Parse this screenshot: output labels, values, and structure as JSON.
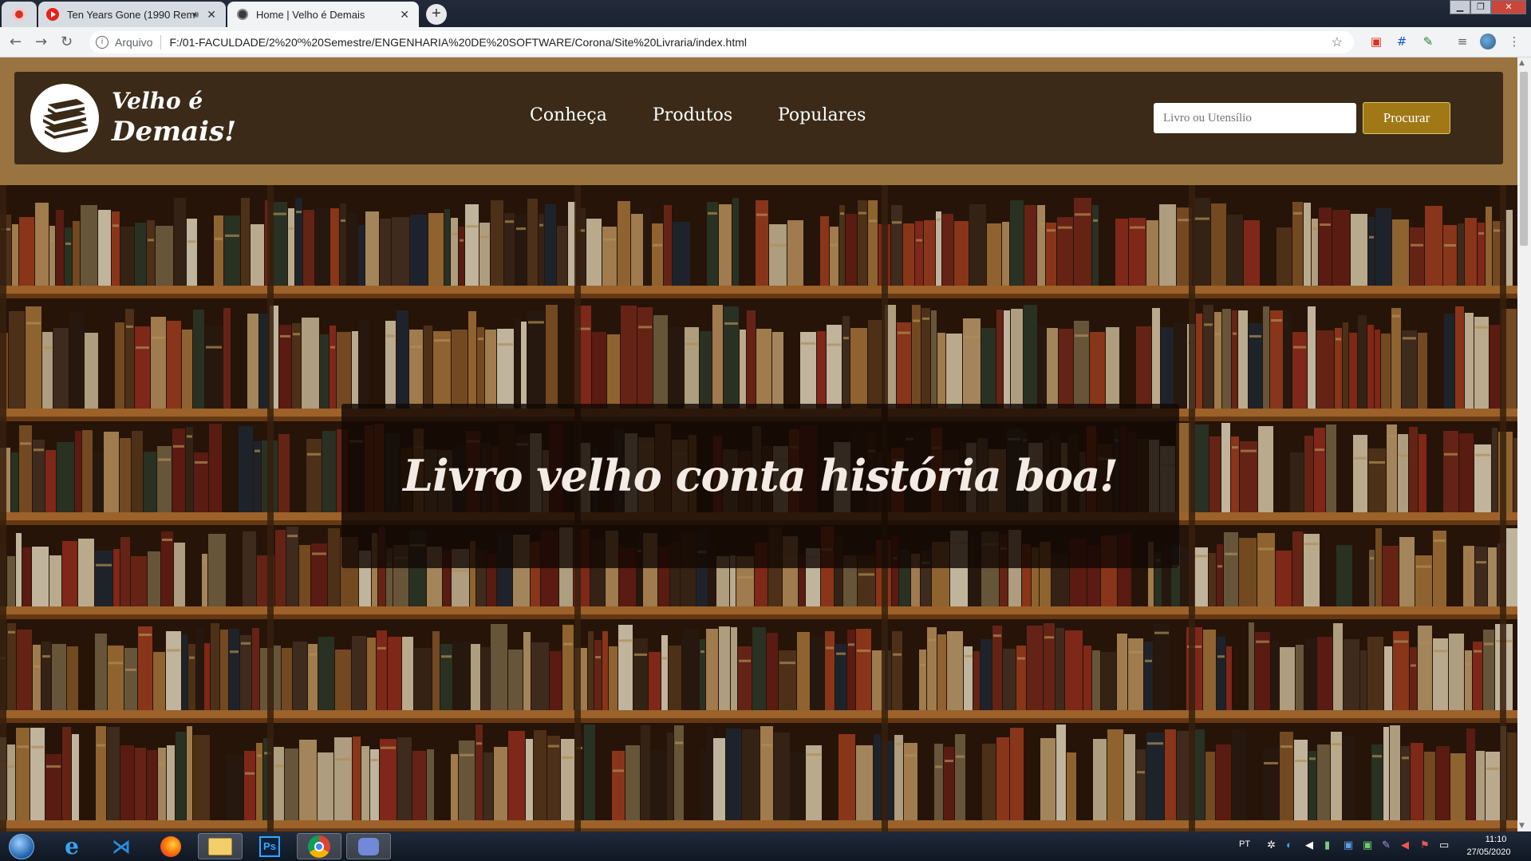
{
  "browser": {
    "tabs": [
      {
        "title": "Ten Years Gone (1990 Remaster)",
        "active": false,
        "audio": true
      },
      {
        "title": "Home | Velho é Demais",
        "active": true,
        "audio": false
      }
    ],
    "address": {
      "security_label": "Arquivo",
      "url": "F:/01-FACULDADE/2%20º%20Semestre/ENGENHARIA%20DE%20SOFTWARE/Corona/Site%20Livraria/index.html"
    }
  },
  "site": {
    "brand": {
      "line1": "Velho é",
      "line2": "Demais!"
    },
    "nav": [
      {
        "label": "Conheça"
      },
      {
        "label": "Produtos"
      },
      {
        "label": "Populares"
      }
    ],
    "search": {
      "placeholder": "Livro ou Utensílio",
      "value": ""
    },
    "search_button": "Procurar",
    "hero": {
      "headline": "Livro velho conta história boa!"
    }
  },
  "taskbar": {
    "apps": [
      "start-orb",
      "internet-explorer",
      "visual-studio-code",
      "firefox",
      "file-explorer",
      "photoshop",
      "chrome",
      "discord"
    ],
    "active_app": "chrome",
    "language": "PT",
    "time": "11:10",
    "date": "27/05/2020"
  },
  "colors": {
    "nav_background": "#3a2a17",
    "top_band": "#9a7440",
    "button": "#a07816",
    "headline_text": "#f4ece4"
  }
}
